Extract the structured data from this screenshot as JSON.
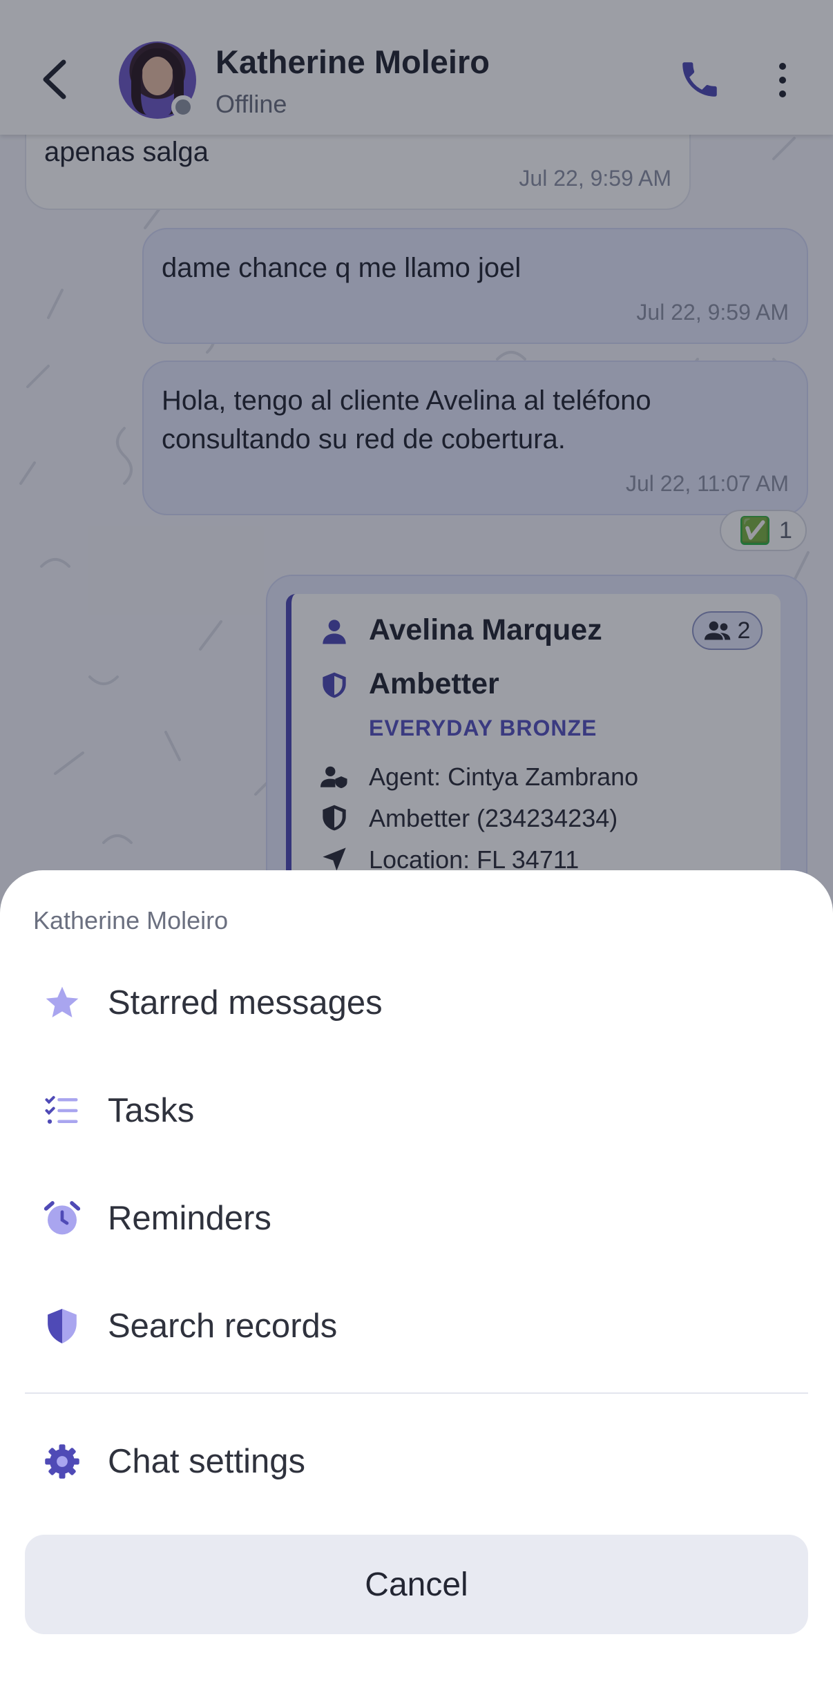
{
  "header": {
    "contact_name": "Katherine Moleiro",
    "status": "Offline",
    "back_icon": "chevron-left-icon",
    "call_icon": "phone-icon",
    "more_icon": "more-vertical-icon"
  },
  "messages": [
    {
      "text": "Bueno voy entrando a meet. Te aviso apenas salga",
      "time": "Jul 22, 9:59 AM",
      "direction": "incoming"
    },
    {
      "text": "dame chance q me llamo joel",
      "time": "Jul 22, 9:59 AM",
      "direction": "outgoing"
    },
    {
      "text": "Hola, tengo al cliente Avelina al teléfono consultando su red de cobertura.",
      "time": "Jul 22, 11:07 AM",
      "direction": "outgoing"
    }
  ],
  "reaction": {
    "emoji": "✅",
    "count": "1"
  },
  "card": {
    "name": "Avelina Marquez",
    "members": "2",
    "carrier": "Ambetter",
    "plan": "EVERYDAY BRONZE",
    "agent": "Agent: Cintya Zambrano",
    "policy": "Ambetter (234234234)",
    "location": "Location: FL 34711"
  },
  "sheet": {
    "title": "Katherine Moleiro",
    "items": [
      {
        "label": "Starred messages",
        "icon": "star-icon"
      },
      {
        "label": "Tasks",
        "icon": "task-list-icon"
      },
      {
        "label": "Reminders",
        "icon": "alarm-clock-icon"
      },
      {
        "label": "Search records",
        "icon": "shield-icon"
      },
      {
        "label": "Chat settings",
        "icon": "gear-icon"
      }
    ],
    "cancel_label": "Cancel"
  },
  "colors": {
    "accent": "#5753c0",
    "accent_light": "#a9a5ef",
    "outgoing_bubble": "#e6e9fb",
    "cancel_bg": "#e8eaf2"
  }
}
